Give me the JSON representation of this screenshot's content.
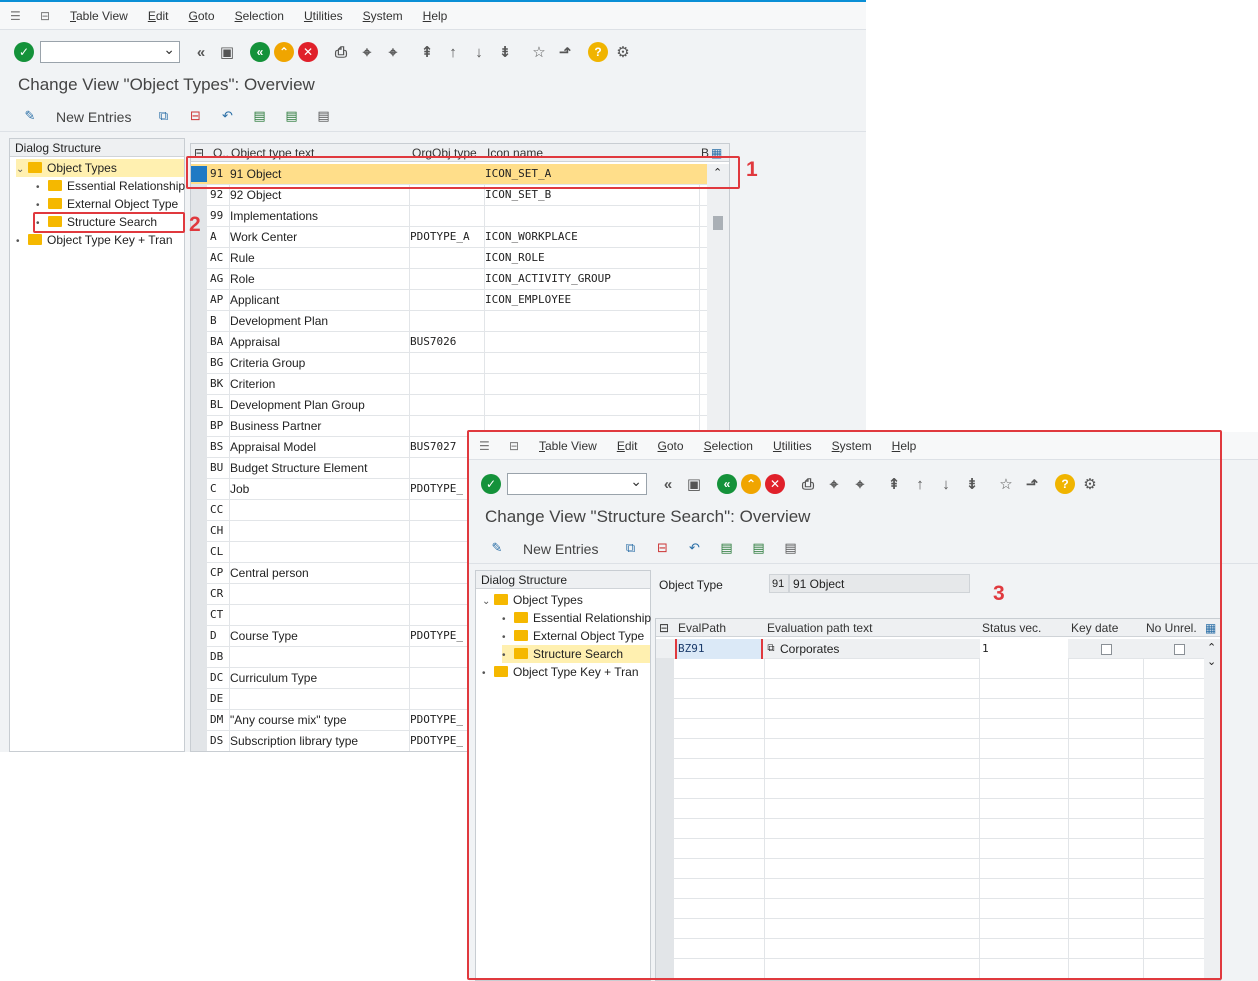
{
  "menu": [
    "Table View",
    "Edit",
    "Goto",
    "Selection",
    "Utilities",
    "System",
    "Help"
  ],
  "main": {
    "title": "Change View \"Object Types\": Overview",
    "new_entries": "New Entries",
    "tree": {
      "header": "Dialog Structure",
      "items": [
        "Object Types",
        "Essential Relationship",
        "External Object Type",
        "Structure Search",
        "Object Type Key + Tran"
      ]
    },
    "columns": [
      "O..",
      "Object type text",
      "OrgObj type",
      "Icon name",
      "B"
    ],
    "rows": [
      [
        "91",
        "91 Object",
        "",
        "ICON_SET_A"
      ],
      [
        "92",
        "92 Object",
        "",
        "ICON_SET_B"
      ],
      [
        "99",
        "Implementations",
        "",
        ""
      ],
      [
        "A",
        "Work Center",
        "PDOTYPE_A",
        "ICON_WORKPLACE"
      ],
      [
        "AC",
        "Rule",
        "",
        "ICON_ROLE"
      ],
      [
        "AG",
        "Role",
        "",
        "ICON_ACTIVITY_GROUP"
      ],
      [
        "AP",
        "Applicant",
        "",
        "ICON_EMPLOYEE"
      ],
      [
        "B",
        "Development Plan",
        "",
        ""
      ],
      [
        "BA",
        "Appraisal",
        "BUS7026",
        ""
      ],
      [
        "BG",
        "Criteria Group",
        "",
        ""
      ],
      [
        "BK",
        "Criterion",
        "",
        ""
      ],
      [
        "BL",
        "Development Plan Group",
        "",
        ""
      ],
      [
        "BP",
        "Business Partner",
        "",
        ""
      ],
      [
        "BS",
        "Appraisal Model",
        "BUS7027",
        ""
      ],
      [
        "BU",
        "Budget Structure Element",
        "",
        ""
      ],
      [
        "C",
        "Job",
        "PDOTYPE_",
        ""
      ],
      [
        "CC",
        "",
        "",
        ""
      ],
      [
        "CH",
        "",
        "",
        ""
      ],
      [
        "CL",
        "",
        "",
        ""
      ],
      [
        "CP",
        "Central person",
        "",
        ""
      ],
      [
        "CR",
        "",
        "",
        ""
      ],
      [
        "CT",
        "",
        "",
        ""
      ],
      [
        "D",
        "Course Type",
        "PDOTYPE_",
        ""
      ],
      [
        "DB",
        "",
        "",
        ""
      ],
      [
        "DC",
        "Curriculum Type",
        "",
        ""
      ],
      [
        "DE",
        "",
        "",
        ""
      ],
      [
        "DM",
        "\"Any course mix\" type",
        "PDOTYPE_",
        ""
      ],
      [
        "DS",
        "Subscription library type",
        "PDOTYPE_",
        ""
      ]
    ]
  },
  "popup": {
    "title": "Change View \"Structure Search\": Overview",
    "new_entries": "New Entries",
    "tree": {
      "header": "Dialog Structure",
      "items": [
        "Object Types",
        "Essential Relationship",
        "External Object Type",
        "Structure Search",
        "Object Type Key + Tran"
      ]
    },
    "object_type_label": "Object Type",
    "object_type_code": "91",
    "object_type_text": "91 Object",
    "columns": [
      "EvalPath",
      "Evaluation path text",
      "Status vec.",
      "Key date",
      "No Unrel."
    ],
    "row": {
      "evalpath": "BZ91",
      "text": "Corporates",
      "status": "1"
    }
  },
  "annotations": [
    "1",
    "2",
    "3"
  ],
  "colors": {
    "accent": "#0a8fd6",
    "highlight": "#e0393e",
    "selected_row": "#ffde8a"
  }
}
